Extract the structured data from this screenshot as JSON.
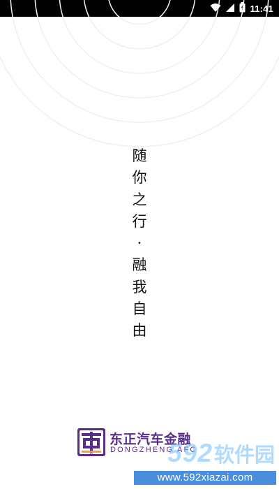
{
  "status_bar": {
    "time": "11:41",
    "icons": [
      "wifi-icon",
      "signal-icon",
      "battery-icon"
    ],
    "background": "#000000"
  },
  "slogan": {
    "chars": [
      "随",
      "你",
      "之",
      "行",
      "·",
      "融",
      "我",
      "自",
      "由"
    ]
  },
  "brand": {
    "name": "东正汽车金融",
    "subname": "DONGZHENG AFC",
    "logo_icon": "dongzheng-logo-icon",
    "color": "#5a2e87"
  },
  "watermark": {
    "number": "592",
    "name": "软件园",
    "url": "www.592xiazai.com",
    "color": "#1e6ed2"
  }
}
